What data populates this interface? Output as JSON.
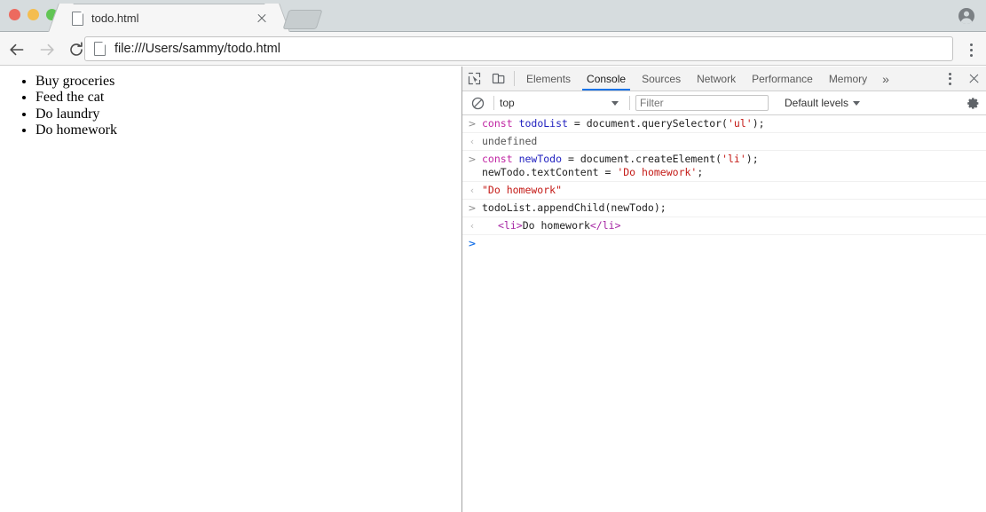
{
  "browser": {
    "window_controls": [
      {
        "name": "close",
        "color": "#ec6a5f"
      },
      {
        "name": "minimize",
        "color": "#f4bd4f"
      },
      {
        "name": "maximize",
        "color": "#61c554"
      }
    ],
    "tab": {
      "title": "todo.html",
      "favicon": "page-icon",
      "close_label": "×"
    },
    "new_tab_label": "",
    "profile_icon": "account-circle-icon",
    "nav": {
      "back_label": "←",
      "forward_label": "→",
      "reload_label": "⟳"
    },
    "omnibox": {
      "url": "file:///Users/sammy/todo.html",
      "page_icon": "document-icon"
    },
    "menu_icon": "kebab-menu-icon"
  },
  "page": {
    "todos": [
      "Buy groceries",
      "Feed the cat",
      "Do laundry",
      "Do homework"
    ]
  },
  "devtools": {
    "toolbar_icons": [
      {
        "name": "inspect-element-icon"
      },
      {
        "name": "device-toolbar-icon"
      }
    ],
    "tabs": [
      {
        "label": "Elements",
        "active": false
      },
      {
        "label": "Console",
        "active": true
      },
      {
        "label": "Sources",
        "active": false
      },
      {
        "label": "Network",
        "active": false
      },
      {
        "label": "Performance",
        "active": false
      },
      {
        "label": "Memory",
        "active": false
      }
    ],
    "overflow_label": "»",
    "more_icon": "kebab-menu-icon",
    "close_icon": "close-icon",
    "active_tab_accent": "#1a73e8",
    "filterbar": {
      "clear_icon": "clear-console-icon",
      "context": "top",
      "filter_placeholder": "Filter",
      "levels": "Default levels",
      "settings_icon": "gear-icon"
    },
    "console_rows": [
      {
        "marker": ">",
        "type": "input",
        "tokens": [
          {
            "t": "const",
            "c": "kw"
          },
          {
            "t": " ",
            "c": "plain"
          },
          {
            "t": "todoList",
            "c": "var"
          },
          {
            "t": " = ",
            "c": "op"
          },
          {
            "t": "document.querySelector(",
            "c": "plain"
          },
          {
            "t": "'ul'",
            "c": "str"
          },
          {
            "t": ");",
            "c": "plain"
          }
        ]
      },
      {
        "marker": "‹",
        "type": "output",
        "tokens": [
          {
            "t": "undefined",
            "c": "res"
          }
        ]
      },
      {
        "marker": ">",
        "type": "input",
        "tokens": [
          {
            "t": "const",
            "c": "kw"
          },
          {
            "t": " ",
            "c": "plain"
          },
          {
            "t": "newTodo",
            "c": "var"
          },
          {
            "t": " = ",
            "c": "op"
          },
          {
            "t": "document.createElement(",
            "c": "plain"
          },
          {
            "t": "'li'",
            "c": "str"
          },
          {
            "t": ");\n",
            "c": "plain"
          },
          {
            "t": "newTodo.textContent = ",
            "c": "plain"
          },
          {
            "t": "'Do homework'",
            "c": "str"
          },
          {
            "t": ";",
            "c": "plain"
          }
        ]
      },
      {
        "marker": "‹",
        "type": "output",
        "tokens": [
          {
            "t": "\"Do homework\"",
            "c": "err"
          }
        ]
      },
      {
        "marker": ">",
        "type": "input",
        "tokens": [
          {
            "t": "todoList.appendChild(newTodo);",
            "c": "plain"
          }
        ]
      },
      {
        "marker": "‹",
        "type": "output",
        "indent": true,
        "tokens": [
          {
            "t": "<li>",
            "c": "tag"
          },
          {
            "t": "Do homework",
            "c": "txt"
          },
          {
            "t": "</li>",
            "c": "tag"
          }
        ]
      },
      {
        "marker": ">",
        "type": "prompt",
        "tokens": []
      }
    ]
  }
}
